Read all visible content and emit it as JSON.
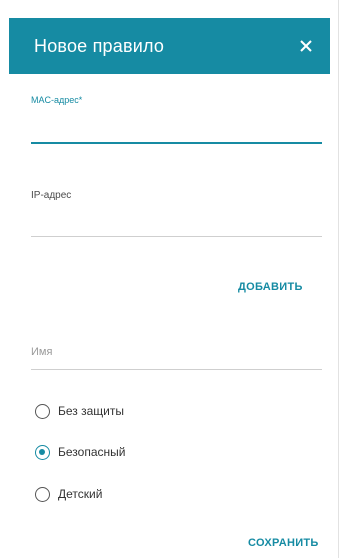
{
  "dialog": {
    "title": "Новое правило",
    "close_icon": "close-icon"
  },
  "mac_field": {
    "label": "MAC-адрес*",
    "value": ""
  },
  "ip_field": {
    "label": "IP-адрес",
    "value": ""
  },
  "add_button": {
    "label": "ДОБАВИТЬ"
  },
  "name_field": {
    "placeholder": "Имя",
    "value": ""
  },
  "protection": {
    "options": [
      {
        "label": "Без защиты",
        "checked": false
      },
      {
        "label": "Безопасный",
        "checked": true
      },
      {
        "label": "Детский",
        "checked": false
      }
    ]
  },
  "save_button": {
    "label": "СОХРАНИТЬ"
  },
  "colors": {
    "accent": "#168ba3",
    "header_text": "#ffffff"
  }
}
